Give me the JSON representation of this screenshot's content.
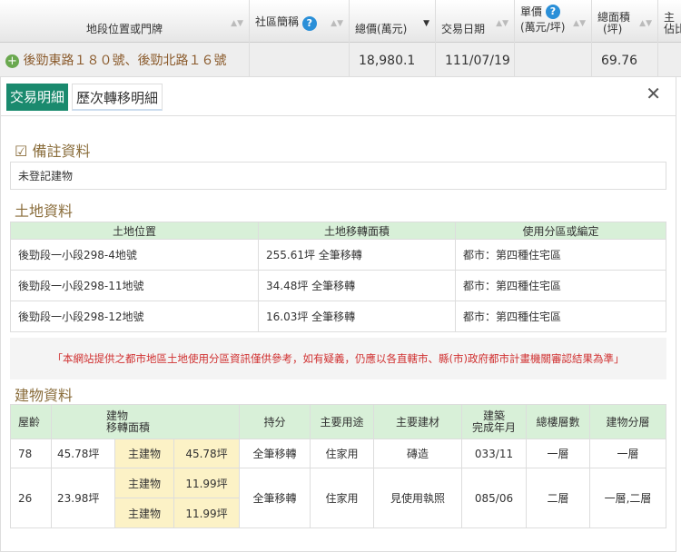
{
  "list_header": {
    "address": "地段位置或門牌",
    "community": "社區簡稱",
    "total_price": "總價(萬元)",
    "date": "交易日期",
    "unit_price": "單價\n(萬元/坪)",
    "unit_price_1": "單價",
    "unit_price_2": "(萬元/坪)",
    "area_1": "總面積",
    "area_2": "(坪)",
    "main_1": "主",
    "main_2": "佔比"
  },
  "list_row": {
    "address": "後勁東路１８０號、後勁北路１６號",
    "total_price": "18,980.1",
    "date": "111/07/19",
    "area": "69.76"
  },
  "tabs": [
    "交易明細",
    "歷次轉移明細"
  ],
  "close": "✕",
  "remarks": {
    "title": "備註資料",
    "value": "未登記建物"
  },
  "land": {
    "title": "土地資料",
    "headers": [
      "土地位置",
      "土地移轉面積",
      "使用分區或編定"
    ],
    "rows": [
      [
        "後勁段一小段298-4地號",
        "255.61坪 全筆移轉",
        "都市：第四種住宅區"
      ],
      [
        "後勁段一小段298-11地號",
        "34.48坪 全筆移轉",
        "都市：第四種住宅區"
      ],
      [
        "後勁段一小段298-12地號",
        "16.03坪 全筆移轉",
        "都市：第四種住宅區"
      ]
    ]
  },
  "notice": "「本網站提供之都市地區土地使用分區資訊僅供參考，如有疑義，仍應以各直轄市、縣(市)政府都市計畫機關審認結果為準」",
  "building": {
    "title": "建物資料",
    "headers": {
      "age": "屋齡",
      "area_1": "建物",
      "area_2": "移轉面積",
      "share": "持分",
      "use": "主要用途",
      "material": "主要建材",
      "built_1": "建築",
      "built_2": "完成年月",
      "floors": "總樓層數",
      "floor": "建物分層"
    },
    "rows": [
      {
        "age": "78",
        "area": "45.78坪",
        "parts": [
          [
            "主建物",
            "45.78坪"
          ]
        ],
        "share": "全筆移轉",
        "use": "住家用",
        "material": "磚造",
        "built": "033/11",
        "floors": "一層",
        "floor": "一層"
      },
      {
        "age": "26",
        "area": "23.98坪",
        "parts": [
          [
            "主建物",
            "11.99坪"
          ],
          [
            "主建物",
            "11.99坪"
          ]
        ],
        "share": "全筆移轉",
        "use": "住家用",
        "material": "見使用執照",
        "built": "085/06",
        "floors": "二層",
        "floor": "一層,二層"
      }
    ]
  }
}
